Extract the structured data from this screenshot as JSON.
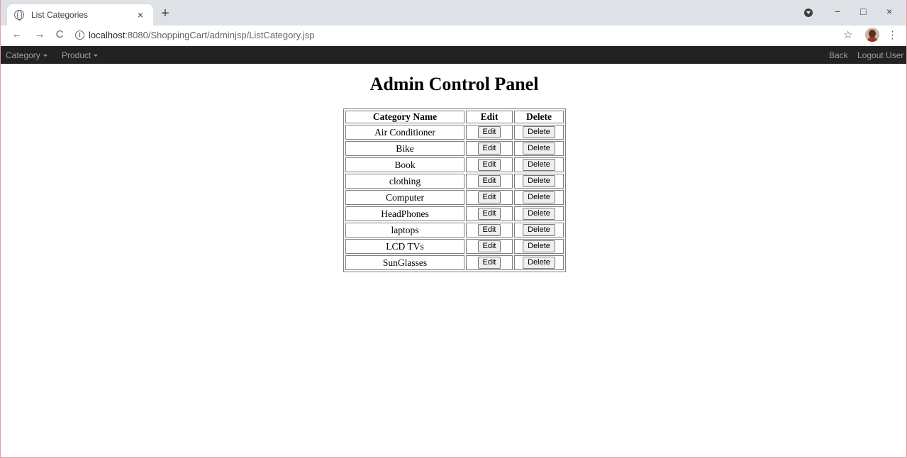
{
  "browser": {
    "tab_title": "List Categories",
    "tab_close": "×",
    "new_tab": "+",
    "url_host": "localhost",
    "url_rest": ":8080/ShoppingCart/adminjsp/ListCategory.jsp",
    "back": "←",
    "forward": "→",
    "reload": "C",
    "star": "☆",
    "menu": "⋮",
    "minimize": "−",
    "maximize": "□",
    "close": "×"
  },
  "navbar": {
    "left": [
      "Category",
      "Product"
    ],
    "right": [
      "Back",
      "Logout User"
    ]
  },
  "page": {
    "title": "Admin Control Panel"
  },
  "table": {
    "headers": [
      "Category Name",
      "Edit",
      "Delete"
    ],
    "edit_label": "Edit",
    "delete_label": "Delete",
    "rows": [
      "Air Conditioner",
      "Bike",
      "Book",
      "clothing",
      "Computer",
      "HeadPhones",
      "laptops",
      "LCD TVs",
      "SunGlasses"
    ]
  },
  "colors": {
    "navbar_bg": "#222222",
    "navbar_text": "#9d9d9d",
    "tabstrip_bg": "#dee1e6"
  }
}
